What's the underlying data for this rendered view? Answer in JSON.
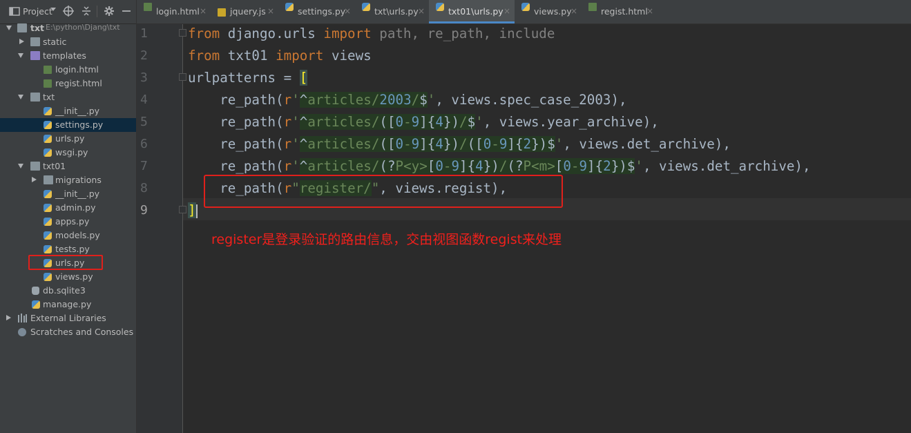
{
  "project_panel": {
    "title": "Project",
    "tree": [
      {
        "label": "txt",
        "hint": "E:\\python\\Djang\\txt"
      },
      {
        "label": "static"
      },
      {
        "label": "templates"
      },
      {
        "label": "login.html"
      },
      {
        "label": "regist.html"
      },
      {
        "label": "txt"
      },
      {
        "label": "__init__.py"
      },
      {
        "label": "settings.py"
      },
      {
        "label": "urls.py"
      },
      {
        "label": "wsgi.py"
      },
      {
        "label": "txt01"
      },
      {
        "label": "migrations"
      },
      {
        "label": "__init__.py"
      },
      {
        "label": "admin.py"
      },
      {
        "label": "apps.py"
      },
      {
        "label": "models.py"
      },
      {
        "label": "tests.py"
      },
      {
        "label": "urls.py"
      },
      {
        "label": "views.py"
      },
      {
        "label": "db.sqlite3"
      },
      {
        "label": "manage.py"
      },
      {
        "label": "External Libraries"
      },
      {
        "label": "Scratches and Consoles"
      }
    ]
  },
  "tabs": [
    {
      "label": "login.html"
    },
    {
      "label": "jquery.js"
    },
    {
      "label": "settings.py"
    },
    {
      "label": "txt\\urls.py"
    },
    {
      "label": "txt01\\urls.py"
    },
    {
      "label": "views.py"
    },
    {
      "label": "regist.html"
    }
  ],
  "tab_close_glyph": "×",
  "editor": {
    "line_numbers": [
      "1",
      "2",
      "3",
      "4",
      "5",
      "6",
      "7",
      "8",
      "9"
    ],
    "current_line": "9",
    "code": {
      "l1": {
        "kw1": "from",
        "mod": " django.urls ",
        "kw2": "import",
        "names": " path, re_path, include"
      },
      "l2": {
        "kw1": "from",
        "mod": " txt01 ",
        "kw2": "import",
        "names": " views"
      },
      "l3": {
        "name": "urlpatterns",
        "eq": " = ",
        "bracket": "["
      },
      "l4": "re_path(r'^articles/2003/$', views.spec_case_2003),",
      "l5": "re_path(r'^articles/([0-9]{4})/$', views.year_archive),",
      "l6": "re_path(r'^articles/([0-9]{4})/([0-9]{2})$', views.det_archive),",
      "l7": "re_path(r'^articles/(?P<y>[0-9]{4})/(?P<m>[0-9]{2})$', views.det_archive),",
      "l8": {
        "func": "re_path(",
        "prefix": "r",
        "q1": "\"",
        "str": "register/",
        "q2": "\"",
        "rest": ", views.regist),"
      },
      "l9": "]"
    }
  },
  "annotation": "register是登录验证的路由信息，交由视图函数regist来处理",
  "colors": {
    "annotation_red": "#e0201b",
    "keyword": "#cc7832",
    "string": "#6a8759",
    "number": "#6897bb",
    "text": "#a9b7c6",
    "selection": "#0d293e"
  }
}
